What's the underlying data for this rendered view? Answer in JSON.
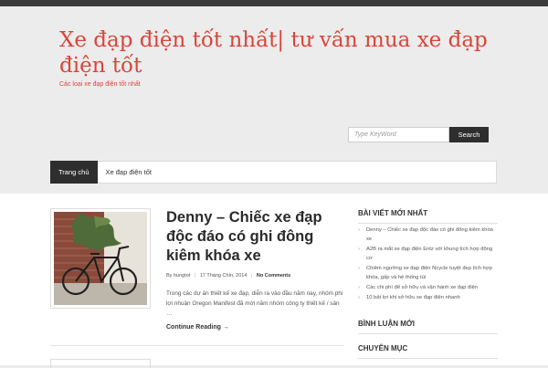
{
  "site": {
    "title": "Xe đạp điện tốt nhất| tư vấn mua xe đạp điện tốt",
    "tagline": "Các loại xe đạp điện tốt nhất"
  },
  "search": {
    "placeholder": "Type KeyWord",
    "button": "Search"
  },
  "nav": {
    "items": [
      {
        "label": "Trang chủ",
        "active": true
      },
      {
        "label": "Xe đạp điện tốt",
        "active": false
      }
    ]
  },
  "post": {
    "title": "Denny – Chiếc xe đạp độc đáo có ghi đông kiêm khóa xe",
    "meta": {
      "prefix": "By",
      "author": "hungtot",
      "date": "17 Tháng Chín, 2014",
      "comments": "No Comments"
    },
    "excerpt": "Trong các dự án thiết kế xe đạp, diễn ra vào đầu năm nay, nhóm phi lợi nhuận Oregon Manifest đã mời năm nhóm công ty thiết kế / sản …",
    "read_more": "Continue Reading →"
  },
  "sidebar": {
    "recent_title": "BÀI VIẾT MỚI NHẤT",
    "recent_posts": [
      "Denny – Chiếc xe đạp độc đáo có ghi đông kiêm khóa xe",
      "A2B ra mắt xe đạp điện Entz với khung tích hợp động cơ",
      "Chiêm ngưỡng xe đạp điện Ncycle tuyệt đẹp tích hợp khóa, gấp và hệ thống túi",
      "Các chi phí để sở hữu và vận hành xe đạp điện",
      "10 bất lợi khi sở hữu xe đạp điện nhanh"
    ],
    "comments_title": "BÌNH LUẬN MỚI",
    "categories_title": "CHUYÊN MỤC"
  },
  "colors": {
    "accent": "#d9453a",
    "dark": "#2e2e2e",
    "header_bg": "#ececec"
  }
}
